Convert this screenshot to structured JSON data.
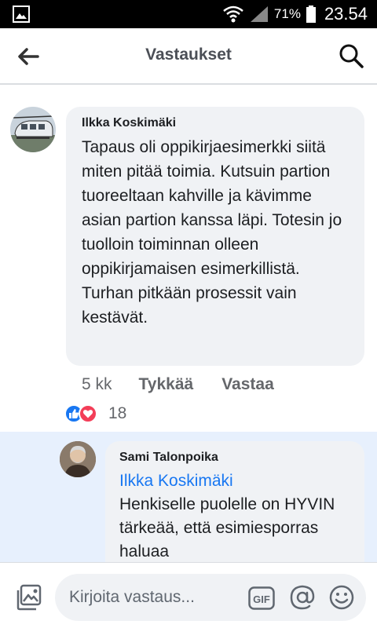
{
  "status_bar": {
    "battery_percent": "71%",
    "time": "23.54"
  },
  "header": {
    "title": "Vastaukset"
  },
  "comments": [
    {
      "author": "Ilkka Koskimäki",
      "text": "Tapaus oli oppikirjaesimerkki siitä miten pitää toimia. Kutsuin partion tuoreeltaan kahville ja kävimme asian partion kanssa läpi. Totesin jo tuolloin toiminnan olleen oppikirjamaisen esimerkillistä. Turhan pitkään prosessit vain kestävät.",
      "time": "5 kk",
      "like_label": "Tykkää",
      "reply_label": "Vastaa",
      "reaction_count": "18"
    },
    {
      "author": "Sami Talonpoika",
      "mention": "Ilkka Koskimäki",
      "text": "Henkiselle puolelle on HYVIN tärkeää, että esimiesporras haluaa"
    }
  ],
  "composer": {
    "placeholder": "Kirjoita vastaus...",
    "gif_label": "GIF"
  },
  "colors": {
    "accent": "#1877f2",
    "love": "#f33e58",
    "highlight_bg": "#e7f0fd",
    "bubble_bg": "#f0f2f5"
  },
  "icons": [
    "gallery-icon",
    "wifi-icon",
    "signal-icon",
    "battery-icon",
    "back-arrow-icon",
    "search-icon",
    "like-reaction-icon",
    "love-reaction-icon",
    "photo-icon",
    "gif-icon",
    "mention-icon",
    "emoji-icon"
  ]
}
